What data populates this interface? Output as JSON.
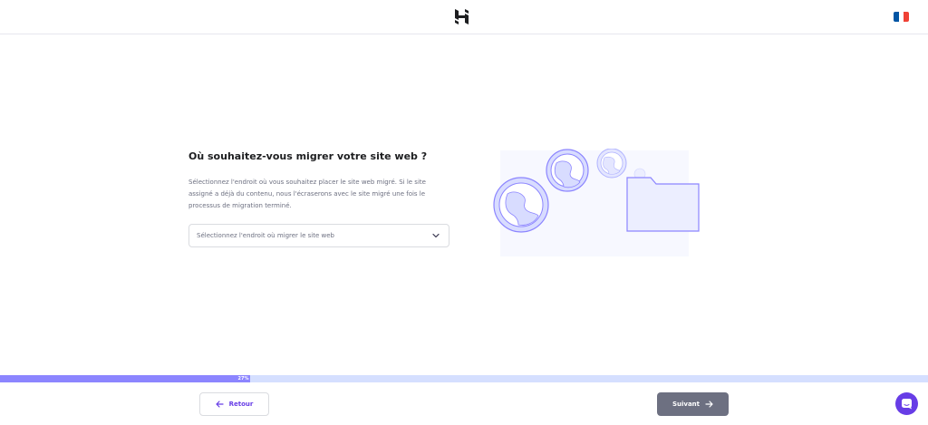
{
  "header": {
    "logo_icon": "hostinger-logo-icon",
    "language_flag": "france-flag-icon",
    "flag_colors": [
      "#0055a4",
      "#ffffff",
      "#ef4135"
    ]
  },
  "main": {
    "title": "Où souhaitez-vous migrer votre site web ?",
    "description": "Sélectionnez l'endroit où vous souhaitez placer le site web migré. Si le site assigné a déjà du contenu, nous l'écraserons avec le site migré une fois le processus de migration terminé.",
    "select_placeholder": "Sélectionnez l'endroit où migrer le site web"
  },
  "progress": {
    "percent": 27,
    "label": "27%"
  },
  "footer": {
    "back_label": "Retour",
    "next_label": "Suivant",
    "chat_icon": "chat-icon"
  },
  "colors": {
    "accent": "#673de6",
    "progress_fill": "#8c85ff",
    "progress_track": "#d5dfff",
    "next_button": "#6d7081"
  }
}
